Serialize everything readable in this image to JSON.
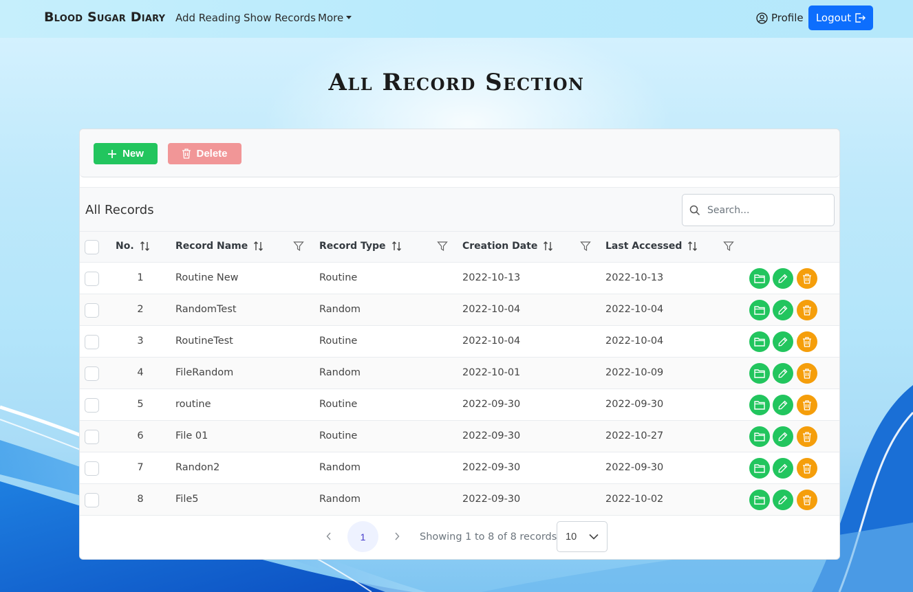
{
  "nav": {
    "brand": "Blood Sugar Diary",
    "links": [
      "Add Reading",
      "Show Records",
      "More"
    ],
    "profile_label": "Profile",
    "logout_label": "Logout"
  },
  "page": {
    "title": "All Record Section"
  },
  "toolbar": {
    "new_label": "New",
    "delete_label": "Delete"
  },
  "table": {
    "title": "All Records",
    "search_placeholder": "Search...",
    "columns": [
      "No.",
      "Record Name",
      "Record Type",
      "Creation Date",
      "Last Accessed"
    ],
    "rows": [
      {
        "no": "1",
        "name": "Routine New",
        "type": "Routine",
        "created": "2022-10-13",
        "accessed": "2022-10-13"
      },
      {
        "no": "2",
        "name": "RandomTest",
        "type": "Random",
        "created": "2022-10-04",
        "accessed": "2022-10-04"
      },
      {
        "no": "3",
        "name": "RoutineTest",
        "type": "Routine",
        "created": "2022-10-04",
        "accessed": "2022-10-04"
      },
      {
        "no": "4",
        "name": "FileRandom",
        "type": "Random",
        "created": "2022-10-01",
        "accessed": "2022-10-09"
      },
      {
        "no": "5",
        "name": "routine",
        "type": "Routine",
        "created": "2022-09-30",
        "accessed": "2022-09-30"
      },
      {
        "no": "6",
        "name": "File 01",
        "type": "Routine",
        "created": "2022-09-30",
        "accessed": "2022-10-27"
      },
      {
        "no": "7",
        "name": "Randon2",
        "type": "Random",
        "created": "2022-09-30",
        "accessed": "2022-09-30"
      },
      {
        "no": "8",
        "name": "File5",
        "type": "Random",
        "created": "2022-09-30",
        "accessed": "2022-10-02"
      }
    ]
  },
  "pagination": {
    "prev_icon": "chevron-left-icon",
    "next_icon": "chevron-right-icon",
    "current_page": "1",
    "info": "Showing 1 to 8 of 8 records",
    "page_size": "10"
  },
  "colors": {
    "primary": "#0d6efd",
    "success": "#22c55e",
    "warning": "#f59e0b",
    "danger_light": "#f19697"
  }
}
